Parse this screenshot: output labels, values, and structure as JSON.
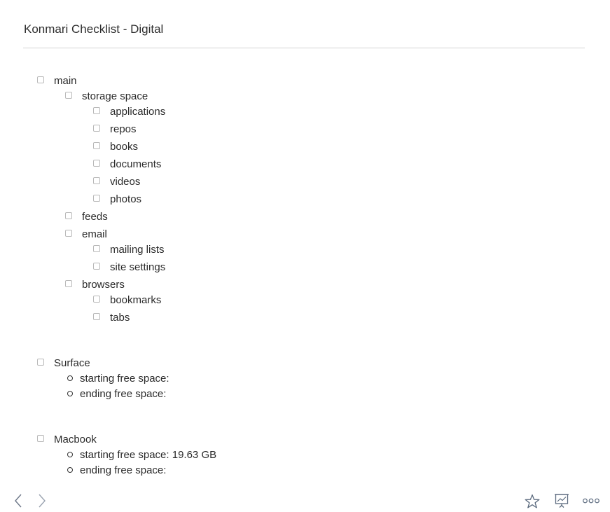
{
  "page": {
    "title": "Konmari Checklist - Digital"
  },
  "checklist": {
    "main": {
      "label": "main",
      "children": {
        "storage": {
          "label": "storage space",
          "items": [
            "applications",
            "repos",
            "books",
            "documents",
            "videos",
            "photos"
          ]
        },
        "feeds": {
          "label": "feeds"
        },
        "email": {
          "label": "email",
          "items": [
            "mailing lists",
            "site settings"
          ]
        },
        "browsers": {
          "label": "browsers",
          "items": [
            "bookmarks",
            "tabs"
          ]
        }
      }
    },
    "surface": {
      "label": "Surface",
      "bullets": [
        "starting free space:",
        "ending free space:"
      ]
    },
    "macbook": {
      "label": "Macbook",
      "bullets": [
        "starting free space: 19.63 GB",
        "ending free space:"
      ]
    }
  },
  "footer": {
    "icons": [
      "back-icon",
      "forward-icon",
      "star-icon",
      "presentation-icon",
      "more-icon"
    ],
    "icon_color": "#5b6a7e"
  }
}
